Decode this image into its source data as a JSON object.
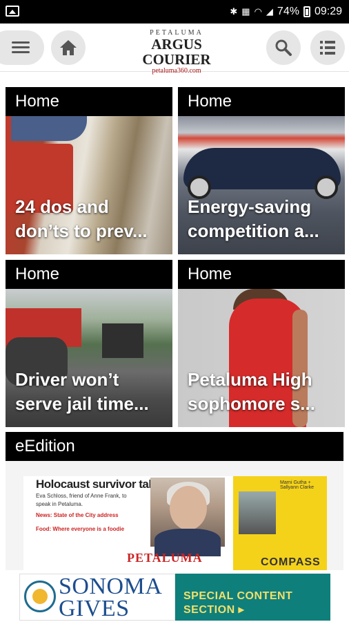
{
  "status_bar": {
    "battery": "74%",
    "time": "09:29",
    "icons": [
      "image-icon",
      "bluetooth-icon",
      "volte-icon",
      "wifi-icon",
      "signal-icon",
      "battery-icon"
    ]
  },
  "app_bar": {
    "logo_top": "PETALUMA",
    "logo_main": "ARGUS COURIER",
    "logo_url": "petaluma360.com"
  },
  "cards": [
    {
      "category": "Home",
      "headline": "24 dos and don’ts to prev..."
    },
    {
      "category": "Home",
      "headline": "Energy-saving competition a..."
    },
    {
      "category": "Home",
      "headline": "Driver won’t serve jail time..."
    },
    {
      "category": "Home",
      "headline": "Petaluma High sophomore s..."
    }
  ],
  "eedition": {
    "category": "eEdition",
    "paper_headline": "Holocaust survivor talk",
    "paper_lines": [
      "Eva Schloss, friend of Anne Frank, to",
      "speak in Petaluma.",
      "News: State of the City address",
      "Food: Where everyone is a foodie"
    ],
    "paper_masthead": "PETALUMA",
    "ad_brand": "COMPASS",
    "ad_names": "Marni Gutha + Sallyann Clarke"
  },
  "banner_ad": {
    "brand_line1": "SONOMA",
    "brand_line2": "GIVES",
    "cta": "SPECIAL CONTENT SECTION ▸"
  }
}
